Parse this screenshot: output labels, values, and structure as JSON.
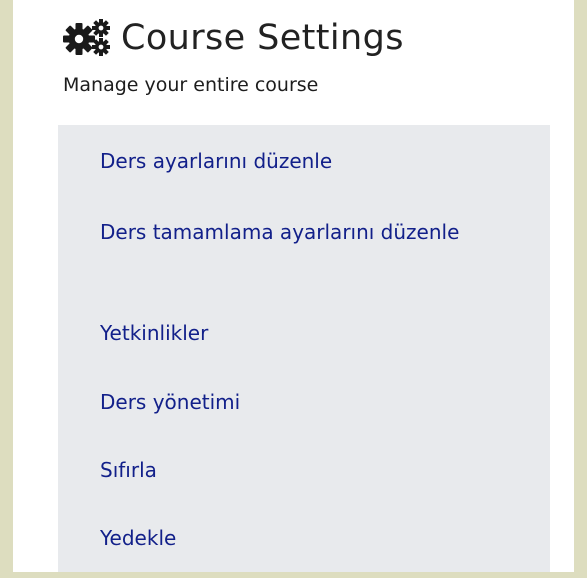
{
  "header": {
    "icon": "gears-icon",
    "title": "Course Settings",
    "subtitle": "Manage your entire course"
  },
  "menu": {
    "items": [
      {
        "label": "Ders ayarlarını düzenle"
      },
      {
        "label": "Ders tamamlama ayarlarını düzenle"
      },
      {
        "label": "Yetkinlikler"
      },
      {
        "label": "Ders yönetimi"
      },
      {
        "label": "Sıfırla"
      },
      {
        "label": "Yedekle"
      }
    ]
  },
  "colors": {
    "outer_background": "#ddddbf",
    "panel_background": "#e8eaed",
    "link_color": "#12208a",
    "text_color": "#222222"
  }
}
